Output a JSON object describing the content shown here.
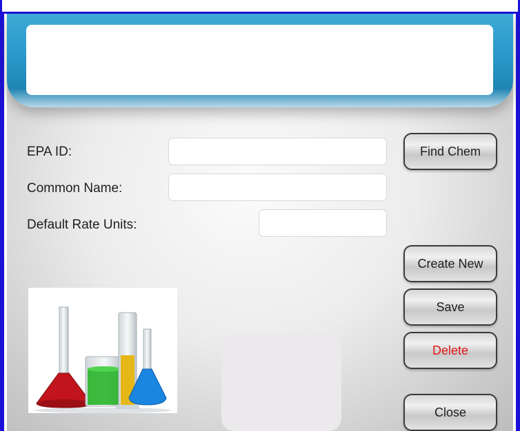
{
  "form": {
    "epa_id_label": "EPA ID:",
    "common_name_label": "Common Name:",
    "default_rate_units_label": "Default Rate Units:",
    "epa_id_value": "",
    "common_name_value": "",
    "default_rate_units_value": ""
  },
  "buttons": {
    "find_chem": "Find Chem",
    "create_new": "Create New",
    "save": "Save",
    "delete": "Delete",
    "close": "Close"
  },
  "colors": {
    "border_blue": "#1b10d8",
    "header_blue": "#2a9bcc",
    "delete_red": "#e01616"
  },
  "image": {
    "icon": "lab-glassware-photo"
  }
}
